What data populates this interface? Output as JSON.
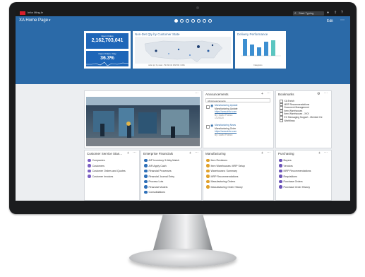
{
  "topbar": {
    "app_name": "Infor Ming.le",
    "search_placeholder": "Start Typing"
  },
  "header": {
    "title": "XA Home Page",
    "edit_label": "Edit",
    "more_label": "⋯",
    "page_dots": [
      true,
      false,
      false,
      false,
      false,
      false,
      false
    ]
  },
  "kpis": [
    {
      "label": "Open Orders",
      "value": "2,162,703,041"
    },
    {
      "label": "Open Orders / Day",
      "value": "36.3%"
    }
  ],
  "map_panel": {
    "title": "Non-Det Qty by Customer State",
    "legend": "order qty by state: <5k 5k 10k 25k 50k >100k"
  },
  "delivery_panel": {
    "title": "Delivery Performance",
    "legend_label": "Categories"
  },
  "cards": {
    "image": {
      "title": "",
      "more": "⋯"
    },
    "announcements": {
      "title": "Announcements",
      "filter": "All Announcements",
      "items": [
        {
          "title": "Manufacturing Update",
          "sub": "Manufacturing Update",
          "link": "https://www.infor.com",
          "meta": "By: David Franco",
          "date": "1/1/2020"
        },
        {
          "title": "Manufacturing News",
          "sub": "Manufacturing Order",
          "link": "https://www.infor.com",
          "meta": "By: David Franco",
          "date": "1/1/2020"
        }
      ]
    },
    "bookmarks": {
      "title": "Bookmarks",
      "items": [
        "XA Enrich",
        "MRP Recommendations",
        "Document Management",
        "Item Warehouses",
        "Item Warehouses - XXX",
        "EC Messaging Support - Member De",
        "Workflows"
      ]
    },
    "customer_service": {
      "title": "Customer Service Stan...",
      "items": [
        "Companies",
        "Customers",
        "Customer Orders and Quotes",
        "Customer Invoices"
      ]
    },
    "enterprise_financials": {
      "title": "Enterprise Financials",
      "items": [
        "A/P Inventory 3-Way Match",
        "A/R Apply Cash",
        "Financial Processes",
        "Financial Journal Entry",
        "Process Lots",
        "Financial Models",
        "Consolidations"
      ]
    },
    "manufacturing": {
      "title": "Manufacturing",
      "items": [
        "Item Revisions",
        "Item Warehouses: MRP Setup",
        "Warehouses: Summary",
        "MRP Recommendations",
        "Manufacturing Orders",
        "Manufacturing Order History"
      ]
    },
    "purchasing": {
      "title": "Purchasing",
      "items": [
        "Buyers",
        "Vendors",
        "MRP Recommendations",
        "Requisitions",
        "Purchase Orders",
        "Purchase Order History"
      ]
    }
  },
  "colors": {
    "brand_blue": "#2b6aa8",
    "kpi_blue": "#1e66b8",
    "logo_red": "#d81e2a"
  }
}
